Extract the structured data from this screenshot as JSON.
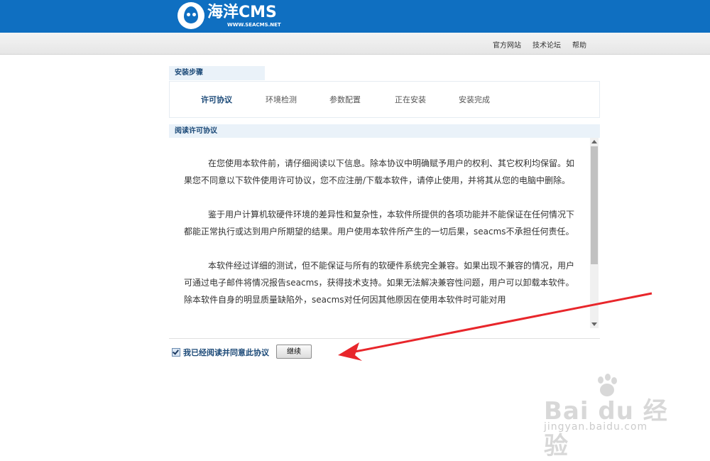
{
  "header": {
    "logo_title": "海洋CMS",
    "logo_subtitle": "WWW.SEACMS.NET",
    "brand_color": "#0f6fc1"
  },
  "toplinks": [
    "官方网站",
    "技术论坛",
    "帮助"
  ],
  "steps": {
    "heading": "安装步骤",
    "items": [
      "许可协议",
      "环境检测",
      "参数配置",
      "正在安装",
      "安装完成"
    ],
    "active_index": 0
  },
  "license": {
    "heading": "阅读许可协议",
    "paragraphs": [
      "在您使用本软件前，请仔细阅读以下信息。除本协议中明确赋予用户的权利、其它权利均保留。如果您不同意以下软件使用许可协议，您不应注册/下载本软件，请停止使用，并将其从您的电脑中删除。",
      "鉴于用户计算机软硬件环境的差异性和复杂性，本软件所提供的各项功能并不能保证在任何情况下都能正常执行或达到用户所期望的结果。用户使用本软件所产生的一切后果，seacms不承担任何责任。",
      "本软件经过详细的测试，但不能保证与所有的软硬件系统完全兼容。如果出现不兼容的情况，用户可通过电子邮件将情况报告seacms，获得技术支持。如果无法解决兼容性问题，用户可以卸载本软件。除本软件自身的明显质量缺陷外，seacms对任何因其他原因在使用本软件时可能对用"
    ]
  },
  "agree": {
    "label": "我已经阅读并同意此协议",
    "checked": true,
    "continue_label": "继续"
  },
  "watermark": {
    "main": "Bai du 经验",
    "sub": "jingyan.baidu.com"
  },
  "annotation_color": "#e8262b"
}
